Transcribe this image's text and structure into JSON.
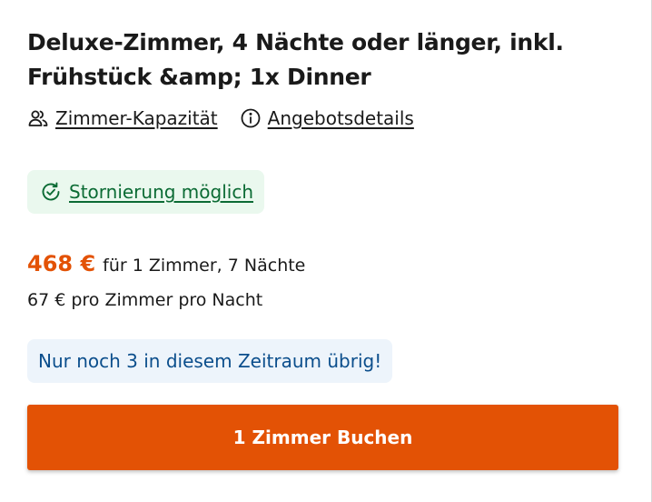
{
  "offer": {
    "title": "Deluxe-Zimmer, 4 Nächte oder länger, inkl. Frühstück &amp; 1x Dinner",
    "links": [
      {
        "label": "Zimmer-Kapazität",
        "icon": "users-icon"
      },
      {
        "label": "Angebotsdetails",
        "icon": "info-icon"
      }
    ],
    "cancellation": {
      "label": "Stornierung möglich",
      "icon": "refresh-check-icon"
    },
    "price": {
      "total": "468 €",
      "total_desc": "für 1 Zimmer, 7 Nächte",
      "per_night": "67 € pro Zimmer pro Nacht"
    },
    "availability": "Nur noch 3 in diesem Zeitraum übrig!",
    "book_button": "1 Zimmer Buchen"
  },
  "colors": {
    "accent": "#e35205",
    "success_bg": "#eaf8ee",
    "success_text": "#0b6b34",
    "info_bg": "#edf4fb",
    "info_text": "#0b4e8c"
  }
}
